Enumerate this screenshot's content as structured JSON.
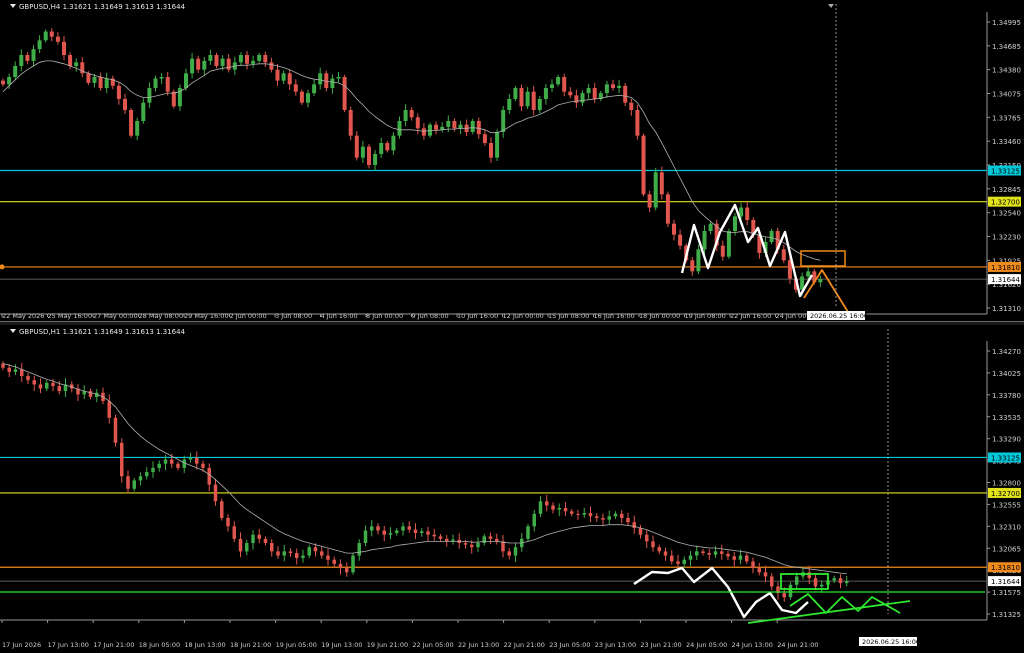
{
  "colors": {
    "background": "#000000",
    "bull": "#3fae49",
    "bear": "#e1574f",
    "ma": "#b0b0b0",
    "level_cyan": "#00c8d8",
    "level_yellow": "#e2e21c",
    "level_orange": "#f08a1c",
    "pattern_white": "#ffffff",
    "projection_orange": "#f08a1c",
    "projection_green": "#2ee82e",
    "grid_text": "#cfcfcf"
  },
  "chart_data": [
    {
      "type": "candlestick",
      "title": "GBPUSD,H4  1.31621 1.31649 1.31613 1.31644",
      "symbol": "GBPUSD",
      "timeframe": "H4",
      "ohlc_header": "1.31621 1.31649 1.31613 1.31644",
      "ylim": [
        1.3125,
        1.3515
      ],
      "y_ticks": [
        "1.34995",
        "1.34685",
        "1.34380",
        "1.34075",
        "1.33765",
        "1.33460",
        "1.33150",
        "1.32845",
        "1.32540",
        "1.32230",
        "1.31925",
        "1.31620",
        "1.31310"
      ],
      "x_ticks": [
        "22 May 2026",
        "25 May 16:00",
        "27 May 00:00",
        "28 May 08:00",
        "29 May 16:00",
        "2 Jun 00:00",
        "3 Jun 08:00",
        "4 Jun 16:00",
        "8 Jun 00:00",
        "9 Jun 08:00",
        "10 Jun 16:00",
        "12 Jun 00:00",
        "15 Jun 08:00",
        "16 Jun 16:00",
        "18 Jun 00:00",
        "19 Jun 08:00",
        "22 Jun 16:00",
        "24 Jun 00:00"
      ],
      "levels": [
        {
          "price": 1.33125,
          "label": "1.33125",
          "color": "cyan"
        },
        {
          "price": 1.327,
          "label": "1.32700",
          "color": "yellow"
        },
        {
          "price": 1.3181,
          "label": "1.31810",
          "color": "orange"
        }
      ],
      "current_price": {
        "price": 1.31644,
        "label": "1.31644"
      },
      "time_marker_label": "2026.06.25 16:00",
      "close_series": [
        1.343,
        1.344,
        1.3455,
        1.347,
        1.3462,
        1.3478,
        1.349,
        1.3502,
        1.3495,
        1.3488,
        1.347,
        1.3455,
        1.346,
        1.3445,
        1.3432,
        1.344,
        1.3425,
        1.3438,
        1.3428,
        1.341,
        1.3395,
        1.336,
        1.338,
        1.3405,
        1.3425,
        1.3438,
        1.344,
        1.342,
        1.34,
        1.3425,
        1.3445,
        1.3465,
        1.345,
        1.3462,
        1.347,
        1.3455,
        1.3465,
        1.345,
        1.346,
        1.347,
        1.3458,
        1.3462,
        1.347,
        1.346,
        1.345,
        1.3435,
        1.3445,
        1.343,
        1.342,
        1.3405,
        1.3418,
        1.343,
        1.3445,
        1.3425,
        1.3438,
        1.344,
        1.3395,
        1.336,
        1.333,
        1.3345,
        1.332,
        1.3335,
        1.335,
        1.334,
        1.336,
        1.338,
        1.3395,
        1.3385,
        1.337,
        1.336,
        1.3375,
        1.3368,
        1.3372,
        1.338,
        1.337,
        1.3375,
        1.3365,
        1.338,
        1.3362,
        1.335,
        1.333,
        1.3365,
        1.3395,
        1.341,
        1.3425,
        1.34,
        1.342,
        1.3395,
        1.341,
        1.3425,
        1.343,
        1.344,
        1.342,
        1.3415,
        1.3405,
        1.3418,
        1.3425,
        1.341,
        1.3418,
        1.343,
        1.3425,
        1.3428,
        1.3405,
        1.3395,
        1.336,
        1.328,
        1.3262,
        1.331,
        1.328,
        1.324,
        1.3225,
        1.321,
        1.319,
        1.3175,
        1.3205,
        1.323,
        1.324,
        1.321,
        1.3195,
        1.323,
        1.325,
        1.3262,
        1.3245,
        1.3225,
        1.32,
        1.3215,
        1.323,
        1.3205,
        1.319,
        1.3165,
        1.315,
        1.3168,
        1.3175,
        1.316,
        1.31644
      ],
      "ma_series": [
        1.342,
        1.3428,
        1.3436,
        1.3444,
        1.345,
        1.3455,
        1.346,
        1.3462,
        1.3462,
        1.346,
        1.3458,
        1.3455,
        1.3452,
        1.3448,
        1.3445,
        1.3442,
        1.344,
        1.3438,
        1.3436,
        1.3433,
        1.3428,
        1.342,
        1.3415,
        1.3412,
        1.3412,
        1.3414,
        1.3416,
        1.3418,
        1.3418,
        1.342,
        1.3425,
        1.3432,
        1.3437,
        1.3442,
        1.3448,
        1.345,
        1.3452,
        1.3453,
        1.3455,
        1.3456,
        1.3456,
        1.3457,
        1.3458,
        1.3458,
        1.3457,
        1.3455,
        1.3453,
        1.345,
        1.3446,
        1.3442,
        1.3439,
        1.3437,
        1.3436,
        1.3434,
        1.3433,
        1.3432,
        1.3428,
        1.342,
        1.341,
        1.3402,
        1.3393,
        1.3386,
        1.338,
        1.3374,
        1.337,
        1.3368,
        1.3368,
        1.3368,
        1.3367,
        1.3366,
        1.3367,
        1.3367,
        1.3368,
        1.3369,
        1.3369,
        1.337,
        1.337,
        1.3371,
        1.337,
        1.3368,
        1.3364,
        1.3364,
        1.3367,
        1.3372,
        1.3377,
        1.338,
        1.3384,
        1.3386,
        1.3389,
        1.3393,
        1.3397,
        1.3402,
        1.3404,
        1.3406,
        1.3407,
        1.3408,
        1.3409,
        1.341,
        1.3411,
        1.3413,
        1.3414,
        1.3415,
        1.3414,
        1.3412,
        1.3405,
        1.3392,
        1.3376,
        1.3365,
        1.335,
        1.3334,
        1.3318,
        1.3302,
        1.3286,
        1.327,
        1.3258,
        1.325,
        1.3243,
        1.3236,
        1.323,
        1.3228,
        1.3228,
        1.3229,
        1.3229,
        1.3227,
        1.3224,
        1.3222,
        1.3221,
        1.3218,
        1.3214,
        1.3208,
        1.3202,
        1.3198,
        1.3195,
        1.3192,
        1.319
      ]
    },
    {
      "type": "candlestick",
      "title": "GBPUSD,H1  1.31621 1.31649 1.31613 1.31644",
      "symbol": "GBPUSD",
      "timeframe": "H1",
      "ohlc_header": "1.31621 1.31649 1.31613 1.31644",
      "ylim": [
        1.3125,
        1.344
      ],
      "y_ticks": [
        "1.34270",
        "1.34025",
        "1.33780",
        "1.33535",
        "1.33290",
        "1.33045",
        "1.32800",
        "1.32555",
        "1.32310",
        "1.32065",
        "1.31820",
        "1.31575",
        "1.31325"
      ],
      "x_ticks": [
        "17 Jun 2026",
        "17 Jun 13:00",
        "17 Jun 21:00",
        "18 Jun 05:00",
        "18 Jun 13:00",
        "18 Jun 21:00",
        "19 Jun 05:00",
        "19 Jun 13:00",
        "19 Jun 21:00",
        "22 Jun 05:00",
        "22 Jun 13:00",
        "22 Jun 21:00",
        "23 Jun 05:00",
        "23 Jun 13:00",
        "23 Jun 21:00",
        "24 Jun 05:00",
        "24 Jun 13:00",
        "24 Jun 21:00"
      ],
      "levels": [
        {
          "price": 1.33125,
          "label": "1.33125",
          "color": "cyan"
        },
        {
          "price": 1.327,
          "label": "1.32700",
          "color": "yellow"
        },
        {
          "price": 1.3181,
          "label": "1.31810",
          "color": "orange"
        }
      ],
      "current_price": {
        "price": 1.31644,
        "label": "1.31644"
      },
      "time_marker_label": "2026.06.25 16:00",
      "close_series": [
        1.342,
        1.3415,
        1.3418,
        1.341,
        1.3405,
        1.34,
        1.3395,
        1.3402,
        1.3398,
        1.3392,
        1.34,
        1.3395,
        1.3388,
        1.3392,
        1.3385,
        1.339,
        1.338,
        1.336,
        1.333,
        1.329,
        1.3275,
        1.3285,
        1.329,
        1.3295,
        1.33,
        1.3305,
        1.331,
        1.3305,
        1.33,
        1.331,
        1.3312,
        1.3305,
        1.33,
        1.328,
        1.326,
        1.324,
        1.323,
        1.3215,
        1.32,
        1.321,
        1.322,
        1.3215,
        1.321,
        1.32,
        1.3195,
        1.32,
        1.3198,
        1.3192,
        1.3195,
        1.3205,
        1.32,
        1.3195,
        1.319,
        1.3185,
        1.318,
        1.3175,
        1.3195,
        1.321,
        1.3225,
        1.323,
        1.3225,
        1.322,
        1.3222,
        1.3225,
        1.323,
        1.3226,
        1.3222,
        1.3224,
        1.322,
        1.3218,
        1.3215,
        1.3212,
        1.3214,
        1.321,
        1.3208,
        1.3205,
        1.321,
        1.3218,
        1.3215,
        1.3212,
        1.32,
        1.3195,
        1.3205,
        1.3215,
        1.323,
        1.3245,
        1.326,
        1.3255,
        1.325,
        1.3252,
        1.3248,
        1.3245,
        1.3244,
        1.3246,
        1.3242,
        1.324,
        1.3238,
        1.3242,
        1.3245,
        1.324,
        1.3235,
        1.3228,
        1.322,
        1.3212,
        1.3205,
        1.32,
        1.3195,
        1.3188,
        1.3185,
        1.319,
        1.3195,
        1.32,
        1.3198,
        1.3196,
        1.32,
        1.3197,
        1.3194,
        1.319,
        1.3195,
        1.3188,
        1.318,
        1.3175,
        1.317,
        1.3158,
        1.315,
        1.3145,
        1.316,
        1.317,
        1.3175,
        1.3168,
        1.3158,
        1.316,
        1.3165,
        1.3168,
        1.3162,
        1.31644
      ],
      "ma_series": [
        1.3425,
        1.3423,
        1.3421,
        1.3418,
        1.3415,
        1.3412,
        1.3409,
        1.3406,
        1.3404,
        1.3401,
        1.3399,
        1.3397,
        1.3394,
        1.3392,
        1.339,
        1.3388,
        1.3385,
        1.338,
        1.3373,
        1.3363,
        1.3353,
        1.3345,
        1.3338,
        1.3332,
        1.3327,
        1.3322,
        1.3318,
        1.3314,
        1.331,
        1.3306,
        1.3303,
        1.33,
        1.3297,
        1.3292,
        1.3286,
        1.3279,
        1.3272,
        1.3264,
        1.3256,
        1.325,
        1.3245,
        1.324,
        1.3235,
        1.323,
        1.3225,
        1.3221,
        1.3218,
        1.3215,
        1.3212,
        1.321,
        1.3208,
        1.3206,
        1.3204,
        1.3202,
        1.32,
        1.3198,
        1.3198,
        1.3199,
        1.32,
        1.3202,
        1.3203,
        1.3204,
        1.3205,
        1.3207,
        1.3208,
        1.3209,
        1.321,
        1.3211,
        1.3212,
        1.3212,
        1.3212,
        1.3212,
        1.3212,
        1.3212,
        1.3212,
        1.3211,
        1.3211,
        1.3212,
        1.3212,
        1.3212,
        1.3211,
        1.321,
        1.321,
        1.321,
        1.3212,
        1.3214,
        1.3217,
        1.322,
        1.3222,
        1.3224,
        1.3226,
        1.3228,
        1.3229,
        1.323,
        1.3231,
        1.3231,
        1.3231,
        1.3232,
        1.3232,
        1.3232,
        1.3231,
        1.323,
        1.3228,
        1.3226,
        1.3223,
        1.322,
        1.3217,
        1.3214,
        1.3211,
        1.3209,
        1.3207,
        1.3206,
        1.3205,
        1.3204,
        1.3204,
        1.3203,
        1.3202,
        1.3201,
        1.32,
        1.3199,
        1.3197,
        1.3195,
        1.3193,
        1.319,
        1.3187,
        1.3184,
        1.3182,
        1.3181,
        1.318,
        1.3179,
        1.3178,
        1.3177,
        1.3176,
        1.3175,
        1.3174,
        1.3173
      ]
    }
  ]
}
